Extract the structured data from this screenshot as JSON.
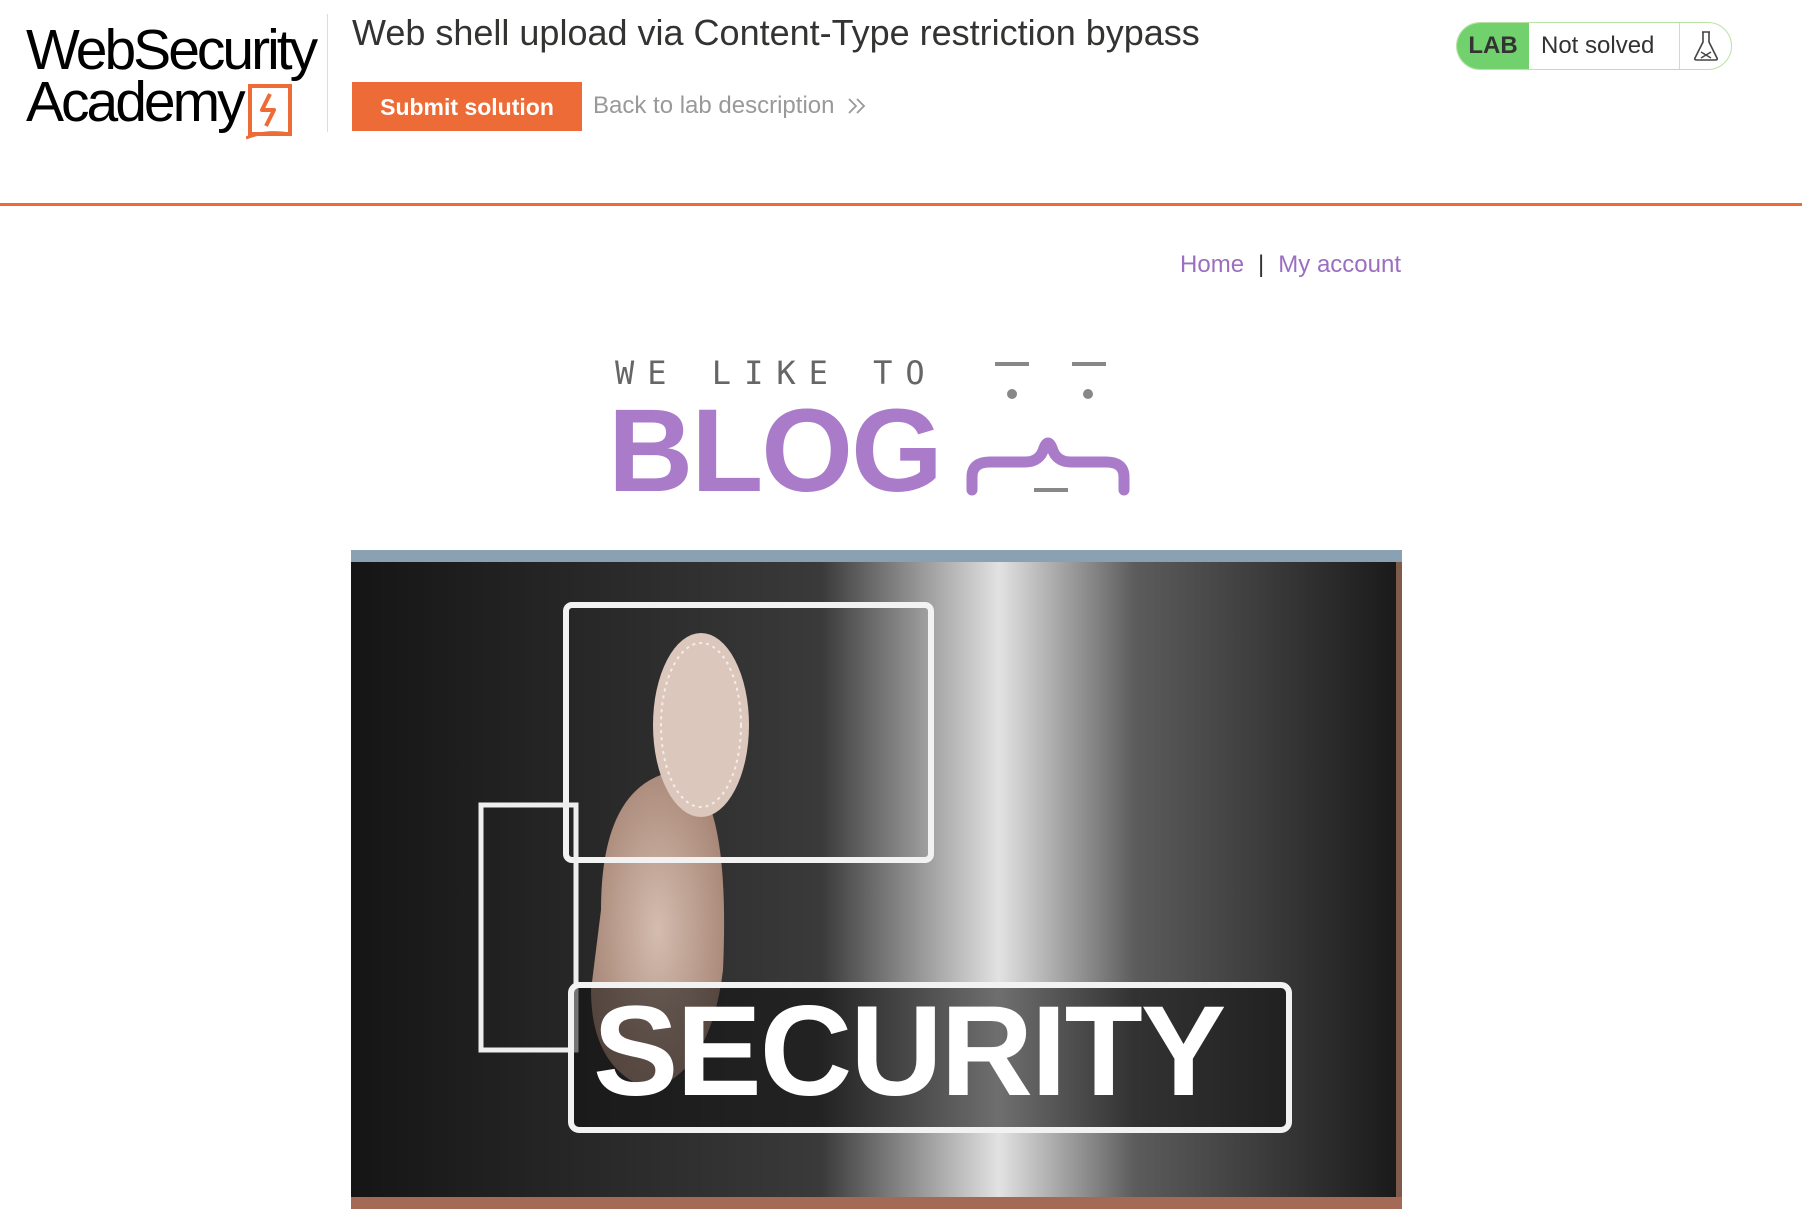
{
  "header": {
    "logo": {
      "line1": "WebSecurity",
      "line2": "Academy"
    },
    "lab_title": "Web shell upload via Content-Type restriction bypass",
    "submit_label": "Submit solution",
    "back_label": "Back to lab description",
    "status": {
      "badge": "LAB",
      "text": "Not solved",
      "icon": "flask-icon"
    }
  },
  "nav": {
    "home": "Home",
    "separator": "|",
    "account": "My account"
  },
  "banner": {
    "tagline": "WE LIKE TO",
    "title": "BLOG"
  },
  "post_image": {
    "caption": "SECURITY"
  },
  "colors": {
    "accent": "#ec6b36",
    "link": "#9b6ec0",
    "blog_purple": "#a97bc9",
    "status_green": "#70d16d"
  }
}
